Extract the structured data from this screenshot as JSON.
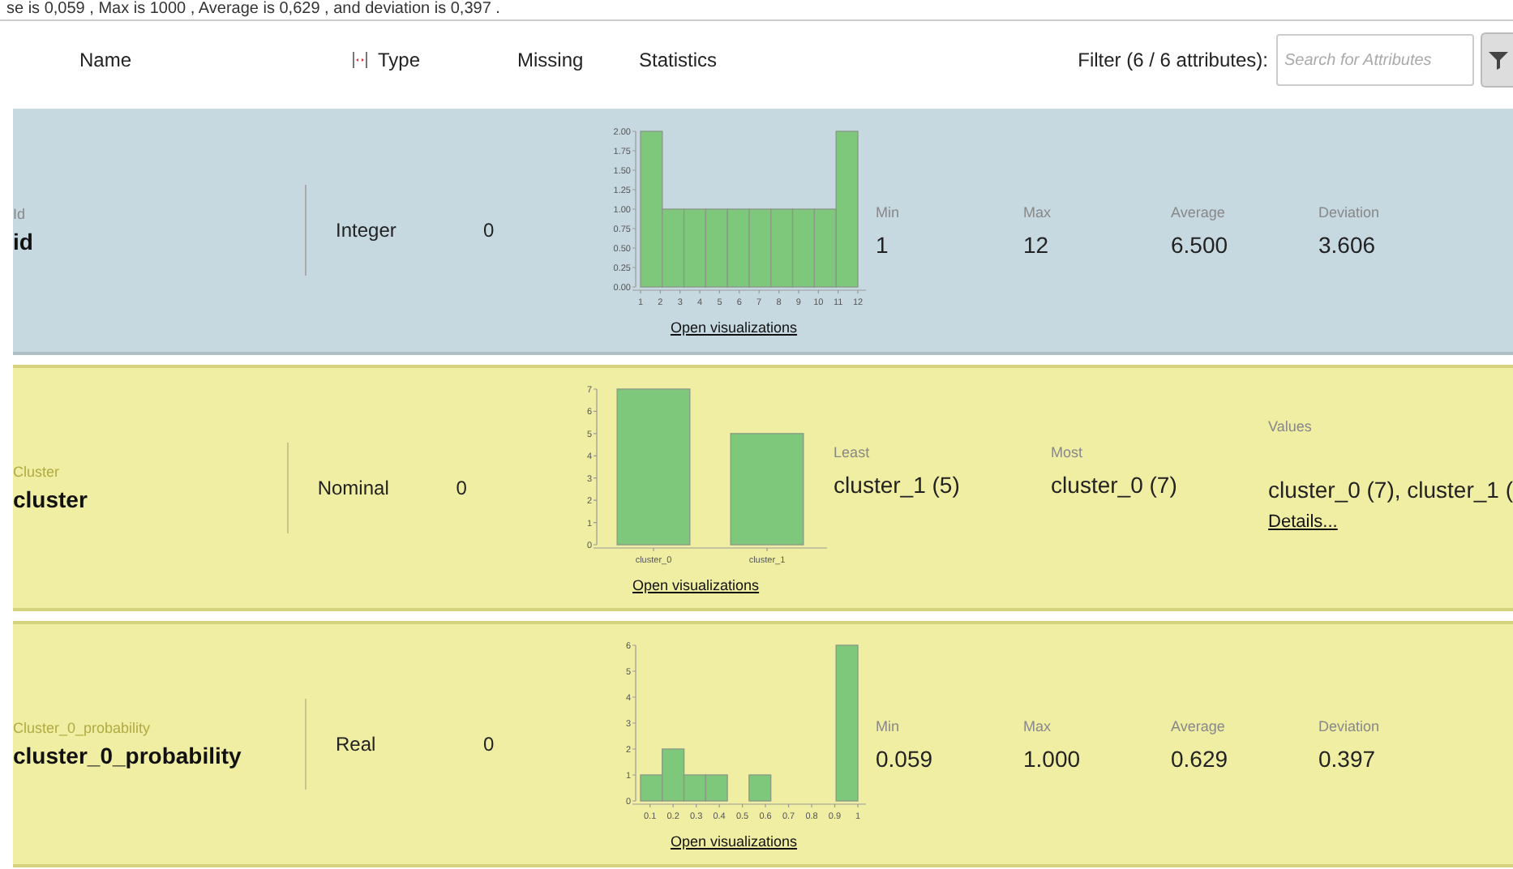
{
  "caption": {
    "text": "se is 0,059 , Max is 1000 , Average is 0,629 , and deviation is 0,397 ."
  },
  "header": {
    "columns": [
      "Name",
      "Type",
      "Missing",
      "Statistics"
    ],
    "filter_label": "Filter (6 / 6 attributes):",
    "search": {
      "placeholder": "Search for Attributes"
    }
  },
  "rows": [
    {
      "kind": "id",
      "role": "Id",
      "name": "id",
      "type": "Integer",
      "missing": "0",
      "link": "Open visualizations",
      "chart_data": {
        "type": "bar",
        "x": [
          1.55,
          2.65,
          3.75,
          4.85,
          5.95,
          7.05,
          8.15,
          9.25,
          10.35,
          11.45
        ],
        "values": [
          2,
          1,
          1,
          1,
          1,
          1,
          1,
          1,
          1,
          2
        ],
        "xlim": [
          1,
          12
        ],
        "ylim": [
          0,
          2
        ],
        "xticks": [
          1,
          2,
          3,
          4,
          5,
          6,
          7,
          8,
          9,
          10,
          11,
          12
        ],
        "yticks": [
          {
            "value": 0,
            "label": "0.00"
          },
          {
            "value": 0.25,
            "label": "0.25"
          },
          {
            "value": 0.5,
            "label": "0.50"
          },
          {
            "value": 0.75,
            "label": "0.75"
          },
          {
            "value": 1,
            "label": "1.00"
          },
          {
            "value": 1.25,
            "label": "1.25"
          },
          {
            "value": 1.5,
            "label": "1.50"
          },
          {
            "value": 1.75,
            "label": "1.75"
          },
          {
            "value": 2,
            "label": "2.00"
          }
        ]
      },
      "stats": [
        {
          "label": "Min",
          "value": "1"
        },
        {
          "label": "Max",
          "value": "12"
        },
        {
          "label": "Average",
          "value": "6.500"
        },
        {
          "label": "Deviation",
          "value": "3.606"
        }
      ]
    },
    {
      "kind": "cluster",
      "role": "Cluster",
      "name": "cluster",
      "type": "Nominal",
      "missing": "0",
      "link": "Open visualizations",
      "chart_data": {
        "type": "bar",
        "categories": [
          "cluster_0",
          "cluster_1"
        ],
        "values": [
          7,
          5
        ],
        "ylim": [
          0,
          7
        ],
        "yticks": [
          0,
          1,
          2,
          3,
          4,
          5,
          6,
          7
        ]
      },
      "stats": [
        {
          "label": "Least",
          "value": "cluster_1 (5)"
        },
        {
          "label": "Most",
          "value": "cluster_0 (7)"
        }
      ],
      "values_summary": {
        "label": "Values",
        "value": "cluster_0 (7), cluster_1 (",
        "link": "Details..."
      }
    },
    {
      "kind": "cluster",
      "role": "Cluster_0_probability",
      "name": "cluster_0_probability",
      "type": "Real",
      "missing": "0",
      "link": "Open visualizations",
      "chart_data": {
        "type": "bar",
        "x": [
          0.106,
          0.2,
          0.294,
          0.388,
          0.482,
          0.576,
          0.671,
          0.765,
          0.859,
          0.953
        ],
        "values": [
          1,
          2,
          1,
          1,
          0,
          1,
          0,
          0,
          0,
          6
        ],
        "xlim": [
          0.059,
          1.0
        ],
        "ylim": [
          0,
          6
        ],
        "xticks": [
          0.1,
          0.2,
          0.3,
          0.4,
          0.5,
          0.6,
          0.7,
          0.8,
          0.9,
          1.0
        ],
        "yticks": [
          0,
          1,
          2,
          3,
          4,
          5,
          6
        ]
      },
      "stats": [
        {
          "label": "Min",
          "value": "0.059"
        },
        {
          "label": "Max",
          "value": "1.000"
        },
        {
          "label": "Average",
          "value": "0.629"
        },
        {
          "label": "Deviation",
          "value": "0.397"
        }
      ]
    }
  ]
}
